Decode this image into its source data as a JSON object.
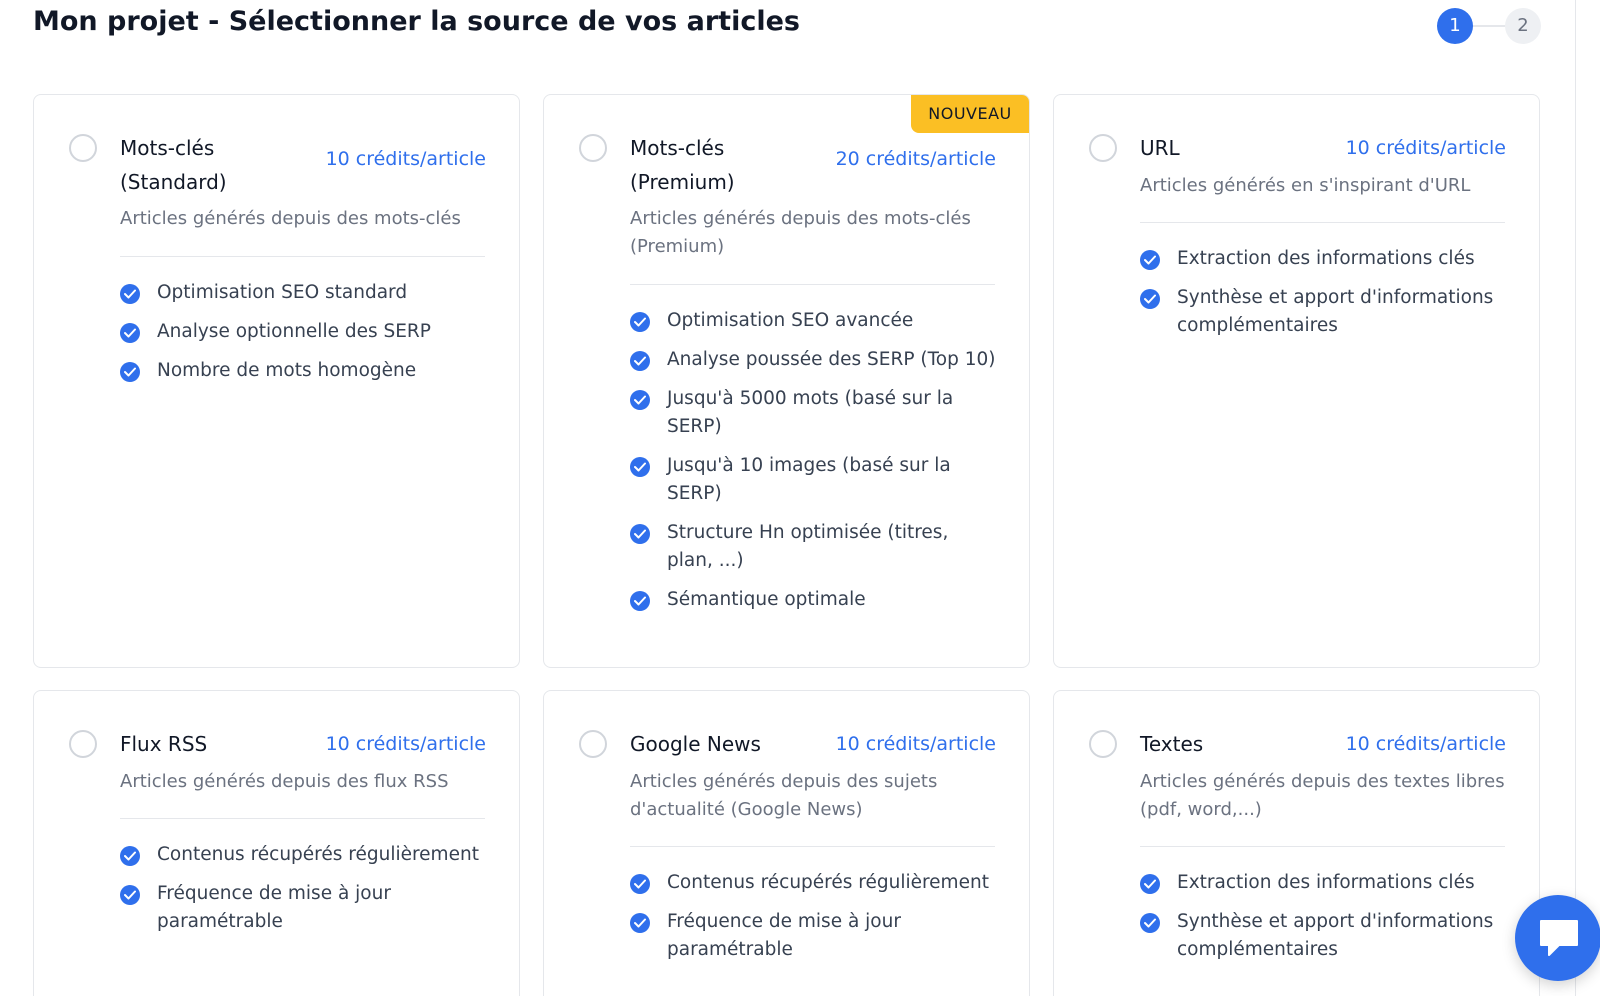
{
  "header": {
    "title": "Mon projet - Sélectionner la source de vos articles",
    "steps": [
      "1",
      "2"
    ],
    "active_step": 1
  },
  "colors": {
    "accent": "#2f6fec",
    "badge": "#fbbf24",
    "border": "#e5e7eb",
    "muted_text": "#6b7280"
  },
  "cards": [
    {
      "title": "Mots-clés (Standard)",
      "credits": "10 crédits/article",
      "description": "Articles générés depuis des mots-clés",
      "badge": "",
      "selected": false,
      "features": [
        "Optimisation SEO standard",
        "Analyse optionnelle des SERP",
        "Nombre de mots homogène"
      ]
    },
    {
      "title": "Mots-clés (Premium)",
      "credits": "20 crédits/article",
      "description": "Articles générés depuis des mots-clés (Premium)",
      "badge": "NOUVEAU",
      "selected": false,
      "features": [
        "Optimisation SEO avancée",
        "Analyse poussée des SERP (Top 10)",
        "Jusqu'à 5000 mots (basé sur la SERP)",
        "Jusqu'à 10 images (basé sur la SERP)",
        "Structure Hn optimisée (titres, plan, ...)",
        "Sémantique optimale"
      ]
    },
    {
      "title": "URL",
      "credits": "10 crédits/article",
      "description": "Articles générés en s'inspirant d'URL",
      "badge": "",
      "selected": false,
      "features": [
        "Extraction des informations clés",
        "Synthèse et apport d'informations complémentaires"
      ]
    },
    {
      "title": "Flux RSS",
      "credits": "10 crédits/article",
      "description": "Articles générés depuis des flux RSS",
      "badge": "",
      "selected": false,
      "features": [
        "Contenus récupérés régulièrement",
        "Fréquence de mise à jour paramétrable"
      ]
    },
    {
      "title": "Google News",
      "credits": "10 crédits/article",
      "description": "Articles générés depuis des sujets d'actualité (Google News)",
      "badge": "",
      "selected": false,
      "features": [
        "Contenus récupérés régulièrement",
        "Fréquence de mise à jour paramétrable"
      ]
    },
    {
      "title": "Textes",
      "credits": "10 crédits/article",
      "description": "Articles générés depuis des textes libres (pdf, word,...)",
      "badge": "",
      "selected": false,
      "features": [
        "Extraction des informations clés",
        "Synthèse et apport d'informations complémentaires"
      ]
    }
  ],
  "chat_widget": {
    "icon": "chat-bubble-icon"
  }
}
